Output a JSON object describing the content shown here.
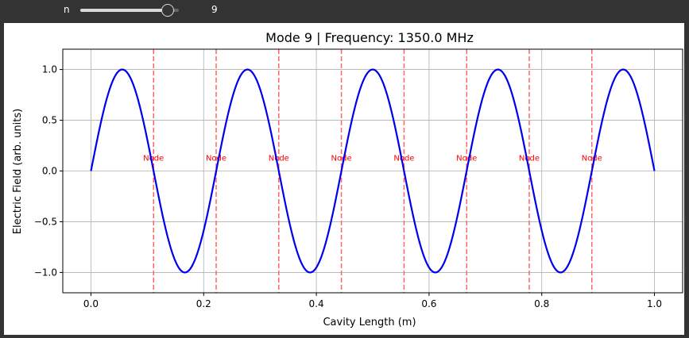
{
  "controls": {
    "slider_label": "n",
    "slider_value": "9",
    "slider_min": 1,
    "slider_max": 10,
    "slider_current": 9
  },
  "chart_data": {
    "type": "line",
    "title": "Mode 9 | Frequency: 1350.0 MHz",
    "xlabel": "Cavity Length (m)",
    "ylabel": "Electric Field (arb. units)",
    "xlim": [
      -0.05,
      1.05
    ],
    "ylim": [
      -1.2,
      1.2
    ],
    "x_ticks": [
      "0.0",
      "0.2",
      "0.4",
      "0.6",
      "0.8",
      "1.0"
    ],
    "x_tick_values": [
      0.0,
      0.2,
      0.4,
      0.6,
      0.8,
      1.0
    ],
    "y_ticks": [
      "1.0",
      "0.5",
      "0.0",
      "−0.5",
      "−1.0"
    ],
    "y_tick_values": [
      1.0,
      0.5,
      0.0,
      -0.5,
      -1.0
    ],
    "grid": true,
    "series": [
      {
        "function": "sin(9*pi*x)",
        "mode": 9,
        "x_range": [
          0,
          1
        ],
        "color": "#0000ee"
      }
    ],
    "nodes": {
      "label": "Node",
      "color": "#ff0000",
      "line_color": "#ff6666",
      "label_y": 0.1,
      "positions": [
        0.1111,
        0.2222,
        0.3333,
        0.4444,
        0.5556,
        0.6667,
        0.7778,
        0.8889
      ]
    }
  }
}
